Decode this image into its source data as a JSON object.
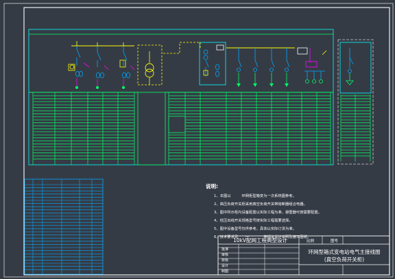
{
  "colors": {
    "background": "#353b45",
    "frame": "#ffffff",
    "schedule_lines": "#00ff66",
    "panel_outline": "#00ffff",
    "busbar": "#ffff00",
    "switch_blue": "#00aaff",
    "magenta": "#ff00ff",
    "notes_text": "#ffffff"
  },
  "notes": {
    "heading": "说明:",
    "items": [
      "1、本图以　　　环网柜型箱变为一次系统图参考。",
      "2、高压负荷开关柜采用真空负荷开关带熔断器组合电器。",
      "3、图中所示柜内设备配置以实际工程为准，避雷器可按需要配置。",
      "4、低压出线开关规格型号按实际工程需要选择。",
      "5、图中设备型号仅供参考，具体以实际订货为准。",
      "6、技术要求见　　～　　　　等相关设计说明及施工图纸。"
    ]
  },
  "title_block": {
    "project": "10kV配网工程典型设计",
    "drawing_title_1": "环网型箱式变电站电气主接线图",
    "drawing_title_2": "(真空负荷开关柜)",
    "field_labels": [
      "批准",
      "审核",
      "校核",
      "设计",
      "制图"
    ],
    "scale_label": "比例",
    "sheet_label": "图号"
  }
}
